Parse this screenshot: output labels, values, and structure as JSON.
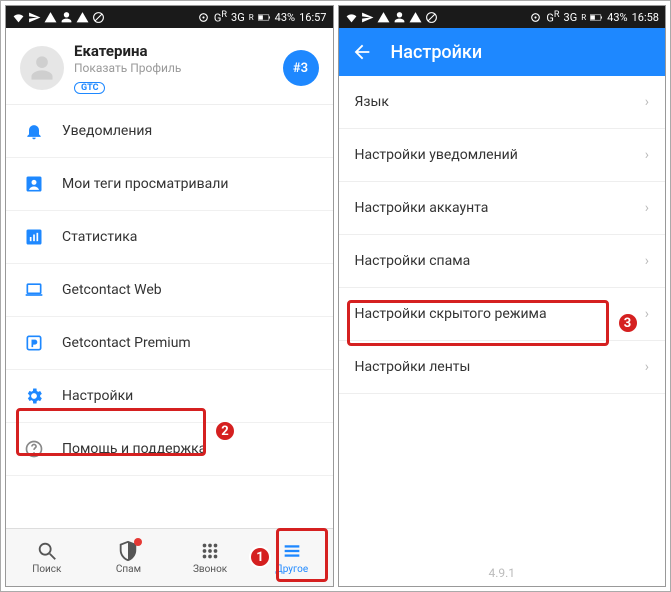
{
  "statusbar_left": {
    "time": "16:57",
    "battery": "43%",
    "signal": "3G"
  },
  "statusbar_right": {
    "time": "16:58",
    "battery": "43%",
    "signal": "3G"
  },
  "left": {
    "profile": {
      "name": "Екатерина",
      "subtitle": "Показать Профиль",
      "badge": "GTC",
      "rank": "#3"
    },
    "menu": [
      {
        "icon": "bell",
        "label": "Уведомления"
      },
      {
        "icon": "person-box",
        "label": "Мои теги просматривали"
      },
      {
        "icon": "stats",
        "label": "Статистика"
      },
      {
        "icon": "laptop",
        "label": "Getcontact Web"
      },
      {
        "icon": "premium",
        "label": "Getcontact Premium"
      },
      {
        "icon": "gear",
        "label": "Настройки"
      },
      {
        "icon": "help",
        "label": "Помощь и поддержка"
      }
    ],
    "bottomnav": [
      {
        "icon": "search",
        "label": "Поиск"
      },
      {
        "icon": "shield",
        "label": "Спам",
        "badge": true
      },
      {
        "icon": "dialpad",
        "label": "Звонок"
      },
      {
        "icon": "menu",
        "label": "Другое",
        "active": true
      }
    ]
  },
  "right": {
    "appbar_title": "Настройки",
    "items": [
      "Язык",
      "Настройки уведомлений",
      "Настройки аккаунта",
      "Настройки спама",
      "Настройки скрытого режима",
      "Настройки ленты"
    ],
    "version": "4.9.1"
  },
  "callouts": {
    "one": "1",
    "two": "2",
    "three": "3"
  }
}
